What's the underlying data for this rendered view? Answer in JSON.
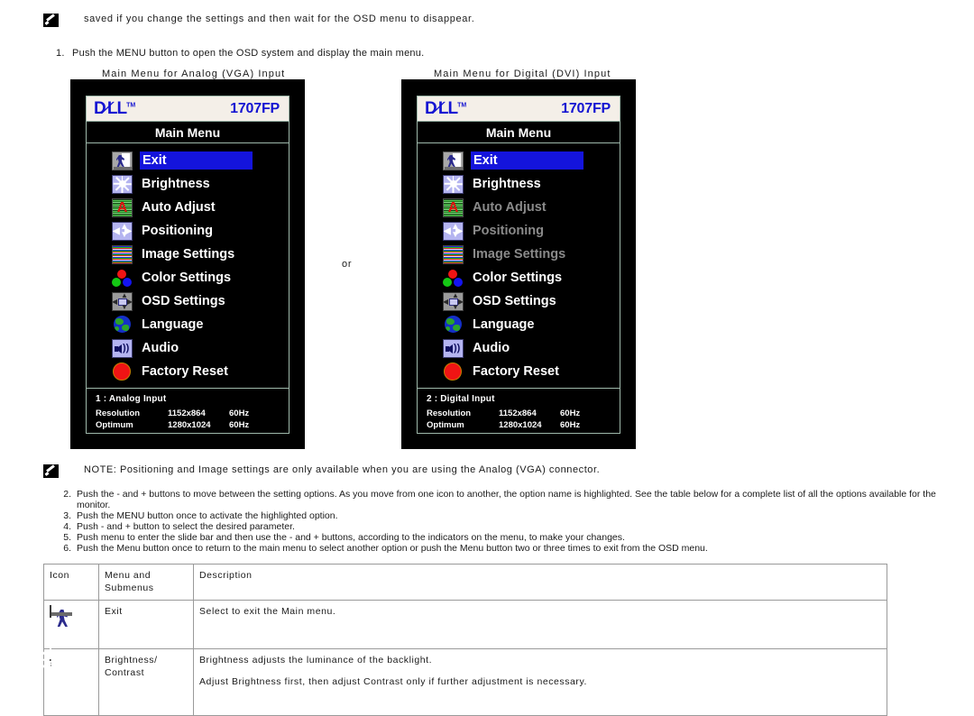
{
  "top_note": {
    "icon": "memo-pencil-icon",
    "text": "saved if you change the settings and then wait for the OSD menu to disappear."
  },
  "step1": {
    "number": "1.",
    "text": "Push the MENU button to open the OSD system and display the main menu."
  },
  "captions": {
    "left": "Main Menu for Analog (VGA) Input",
    "right": "Main Menu for Digital (DVI) Input"
  },
  "or_label": "or",
  "osd_left": {
    "brand": "D⁄LL",
    "brand_tm": "TM",
    "model": "1707FP",
    "title": "Main Menu",
    "items": [
      {
        "label": "Exit",
        "icon": "exit-icon",
        "selected": true,
        "disabled": false
      },
      {
        "label": "Brightness",
        "icon": "brightness-icon",
        "selected": false,
        "disabled": false
      },
      {
        "label": "Auto Adjust",
        "icon": "auto-adjust-icon",
        "selected": false,
        "disabled": false
      },
      {
        "label": "Positioning",
        "icon": "positioning-icon",
        "selected": false,
        "disabled": false
      },
      {
        "label": "Image Settings",
        "icon": "image-settings-icon",
        "selected": false,
        "disabled": false
      },
      {
        "label": "Color Settings",
        "icon": "color-settings-icon",
        "selected": false,
        "disabled": false
      },
      {
        "label": "OSD Settings",
        "icon": "osd-settings-icon",
        "selected": false,
        "disabled": false
      },
      {
        "label": "Language",
        "icon": "language-globe-icon",
        "selected": false,
        "disabled": false
      },
      {
        "label": "Audio",
        "icon": "audio-speaker-icon",
        "selected": false,
        "disabled": false
      },
      {
        "label": "Factory Reset",
        "icon": "factory-reset-icon",
        "selected": false,
        "disabled": false
      }
    ],
    "footer": {
      "input": "1 : Analog Input",
      "rows": [
        {
          "key": "Resolution",
          "value": "1152x864",
          "refresh": "60Hz"
        },
        {
          "key": "Optimum",
          "value": "1280x1024",
          "refresh": "60Hz"
        }
      ]
    }
  },
  "osd_right": {
    "brand": "D⁄LL",
    "brand_tm": "TM",
    "model": "1707FP",
    "title": "Main Menu",
    "items": [
      {
        "label": "Exit",
        "icon": "exit-icon",
        "selected": true,
        "disabled": false
      },
      {
        "label": "Brightness",
        "icon": "brightness-icon",
        "selected": false,
        "disabled": false
      },
      {
        "label": "Auto Adjust",
        "icon": "auto-adjust-icon",
        "selected": false,
        "disabled": true
      },
      {
        "label": "Positioning",
        "icon": "positioning-icon",
        "selected": false,
        "disabled": true
      },
      {
        "label": "Image Settings",
        "icon": "image-settings-icon",
        "selected": false,
        "disabled": true
      },
      {
        "label": "Color Settings",
        "icon": "color-settings-icon",
        "selected": false,
        "disabled": false
      },
      {
        "label": "OSD Settings",
        "icon": "osd-settings-icon",
        "selected": false,
        "disabled": false
      },
      {
        "label": "Language",
        "icon": "language-globe-icon",
        "selected": false,
        "disabled": false
      },
      {
        "label": "Audio",
        "icon": "audio-speaker-icon",
        "selected": false,
        "disabled": false
      },
      {
        "label": "Factory Reset",
        "icon": "factory-reset-icon",
        "selected": false,
        "disabled": false
      }
    ],
    "footer": {
      "input": "2 : Digital Input",
      "rows": [
        {
          "key": "Resolution",
          "value": "1152x864",
          "refresh": "60Hz"
        },
        {
          "key": "Optimum",
          "value": "1280x1024",
          "refresh": "60Hz"
        }
      ]
    }
  },
  "note2": {
    "icon": "memo-pencil-icon",
    "text": "NOTE: Positioning and Image settings are only available when you are using the Analog (VGA) connector."
  },
  "steps": [
    {
      "n": "2.",
      "t": "Push the - and +  buttons to move between the setting options. As you move from one icon to another, the option name is highlighted. See the table below for a complete list of all the options available for the monitor."
    },
    {
      "n": "3.",
      "t": "Push the MENU button once to activate the highlighted option."
    },
    {
      "n": "4.",
      "t": "Push - and + button to select the desired parameter."
    },
    {
      "n": "5.",
      "t": "Push menu to enter the slide bar and then use the - and + buttons, according to the indicators on the menu, to make your changes."
    },
    {
      "n": "6.",
      "t": "Push the Menu button once to return to the main menu to select another option or push the Menu button two or three times to exit from the OSD menu."
    }
  ],
  "table": {
    "headers": {
      "icon": "Icon",
      "menu": "Menu and Submenus",
      "description": "Description"
    },
    "rows": [
      {
        "icon": "exit-icon",
        "menu": "Exit",
        "desc1": "Select to exit the Main menu.",
        "desc2": ""
      },
      {
        "icon": "brightness-contrast-icon",
        "menu": "Brightness/ Contrast",
        "desc1": "Brightness adjusts the  luminance of the backlight.",
        "desc2": "Adjust Brightness first, then adjust Contrast only if further adjustment is necessary."
      }
    ]
  },
  "colors": {
    "osd_background": "#000000",
    "osd_brandbar": "#f4efe8",
    "dell_blue": "#1414d2",
    "highlight_blue": "#1414dc",
    "disabled_gray": "#8a8a8a",
    "osd_border": "#9fb9ab"
  }
}
